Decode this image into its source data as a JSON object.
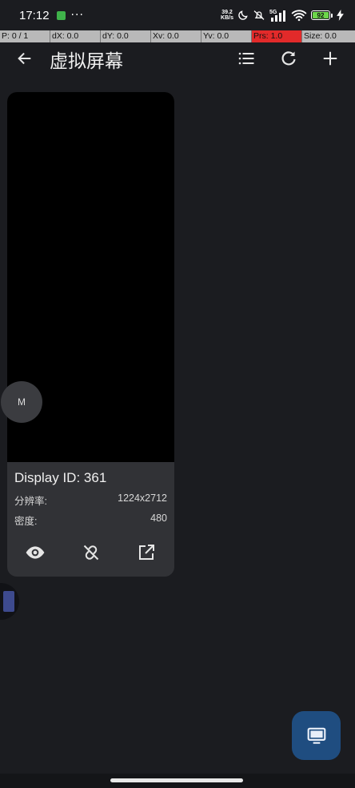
{
  "status_bar": {
    "time": "17:12",
    "dots": "···",
    "net_speed_value": "39.2",
    "net_speed_unit": "KB/s",
    "signal_label": "5G",
    "battery_level": "92"
  },
  "pointer_bar": {
    "cells": [
      "P: 0 / 1",
      "dX: 0.0",
      "dY: 0.0",
      "Xv: 0.0",
      "Yv: 0.0",
      "Prs: 1.0",
      "Size: 0.0"
    ]
  },
  "app_bar": {
    "title": "虚拟屏幕",
    "icons": [
      "arrow-back-icon",
      "list-icon",
      "refresh-icon",
      "add-icon"
    ]
  },
  "display_card": {
    "title": "Display ID: 361",
    "resolution_label": "分辨率:",
    "resolution_value": "1224x2712",
    "density_label": "密度:",
    "density_value": "480",
    "actions": [
      "eye-icon",
      "link-off-icon",
      "open-external-icon"
    ]
  },
  "floating_button": {
    "label": "M"
  },
  "fab": {
    "icon": "monitor-icon",
    "color": "#1f4d80"
  },
  "colors": {
    "background": "#1b1c20",
    "card": "#313236",
    "pointer_highlight": "#e22a2a",
    "battery": "#6cd64a"
  }
}
